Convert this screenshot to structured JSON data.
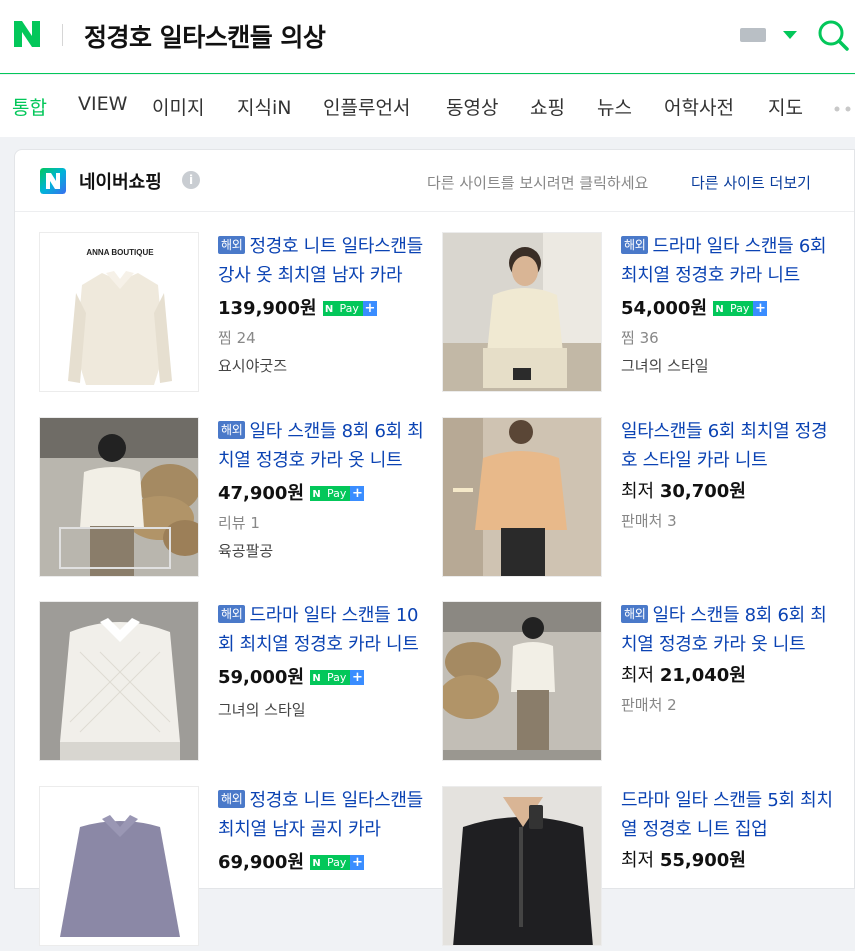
{
  "header": {
    "query": "정경호 일타스캔들 의상"
  },
  "tabs": [
    {
      "label": "통합",
      "active": true
    },
    {
      "label": "VIEW"
    },
    {
      "label": "이미지"
    },
    {
      "label": "지식iN"
    },
    {
      "label": "인플루언서"
    },
    {
      "label": "동영상"
    },
    {
      "label": "쇼핑"
    },
    {
      "label": "뉴스"
    },
    {
      "label": "어학사전"
    },
    {
      "label": "지도"
    }
  ],
  "shopping": {
    "title": "네이버쇼핑",
    "info_icon": "i",
    "note": "다른 사이트를 보시려면 클릭하세요",
    "more_link": "다른 사이트 더보기",
    "badge_overseas": "해외",
    "npay_n": "N",
    "npay_pay": "Pay",
    "npay_plus": "+",
    "products": [
      {
        "title": "정경호 니트 일타스캔들 강사 옷 최치열 남자 카라",
        "overseas": true,
        "price": "139,900원",
        "npay": true,
        "meta": "찜 24",
        "store": "요시야굿즈",
        "thumb_label": "ANNA BOUTIQUE"
      },
      {
        "title": "드라마 일타 스캔들 6회 최치열 정경호 카라 니트",
        "overseas": true,
        "price": "54,000원",
        "npay": true,
        "meta": "찜 36",
        "store": "그녀의 스타일"
      },
      {
        "title": "일타 스캔들 8회 6회 최치열 정경호 카라 옷 니트",
        "overseas": true,
        "price": "47,900원",
        "npay": true,
        "meta": "리뷰 1",
        "store": "육공팔공"
      },
      {
        "title": "일타스캔들 6회 최치열 정경호 스타일 카라 니트",
        "overseas": false,
        "price_prefix": "최저",
        "price": "30,700원",
        "npay": false,
        "meta": "판매처 3",
        "store": ""
      },
      {
        "title": "드라마 일타 스캔들 10회 최치열 정경호 카라 니트",
        "overseas": true,
        "price": "59,000원",
        "npay": true,
        "meta": "",
        "store": "그녀의 스타일"
      },
      {
        "title": "일타 스캔들 8회 6회 최치열 정경호 카라 옷 니트",
        "overseas": true,
        "price_prefix": "최저",
        "price": "21,040원",
        "npay": false,
        "meta": "판매처 2",
        "store": ""
      },
      {
        "title": "정경호 니트 일타스캔들 최치열 남자 골지 카라",
        "overseas": true,
        "price": "69,900원",
        "npay": true,
        "meta": "",
        "store": ""
      },
      {
        "title": "드라마 일타 스캔들 5회 최치열 정경호 니트 집업",
        "overseas": false,
        "price_prefix": "최저",
        "price": "55,900원",
        "npay": false,
        "meta": "",
        "store": ""
      }
    ]
  },
  "colors": {
    "brand": "#03c75a",
    "link": "#0b43b3",
    "overseas_badge": "#4a79c9"
  },
  "icons": [
    "naver-logo-icon",
    "keyboard-icon",
    "chevron-down-icon",
    "search-icon",
    "more-dots-icon",
    "naver-shopping-logo-icon",
    "info-icon"
  ]
}
